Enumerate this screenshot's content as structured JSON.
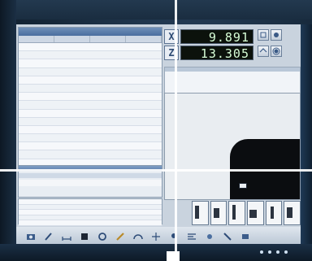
{
  "dro": {
    "x_axis_label": "X",
    "x_value": "9.891",
    "z_axis_label": "Z",
    "z_value": "13.305"
  },
  "table": {
    "rows": 17
  },
  "icons": {
    "toolbar": [
      "camera-icon",
      "probe-icon",
      "measure-icon",
      "square-icon",
      "gear-icon",
      "pencil-icon",
      "arc-icon",
      "crosshair-icon",
      "light-icon",
      "align-icon",
      "fit-icon",
      "tool-icon",
      "settings-icon"
    ],
    "dro_buttons": [
      "zero-icon",
      "hold-icon",
      "home-icon",
      "config-icon"
    ]
  },
  "colors": {
    "dro_background": "#0c120c",
    "dro_text": "#d8ffd8",
    "accent": "#4a6e9f"
  }
}
